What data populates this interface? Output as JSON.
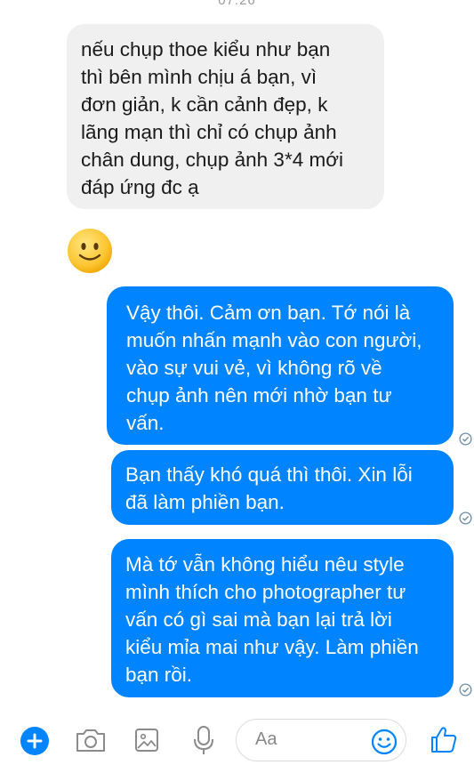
{
  "timestamp": "07:26",
  "messages": [
    {
      "sender": "other",
      "lines": [
        "nếu chụp thoe kiểu như bạn",
        "thì bên mình chịu á bạn, vì",
        "đơn giản, k cần cảnh đẹp, k",
        "lãng mạn thì chỉ có chụp ảnh",
        "chân dung, chụp ảnh 3*4 mới",
        "đáp ứng đc ạ"
      ]
    },
    {
      "sender": "other",
      "type": "emoji",
      "icon": "smiley-emoji-icon"
    },
    {
      "sender": "me",
      "lines": [
        "Vậy thôi. Cảm ơn bạn. Tớ nói là",
        "muốn nhấn mạnh vào con người,",
        "vào sự vui vẻ, vì không rõ về",
        "chụp ảnh nên mới nhờ bạn tư",
        "vấn."
      ]
    },
    {
      "sender": "me",
      "lines": [
        "Bạn thấy khó quá thì thôi. Xin lỗi",
        "đã làm phiền bạn."
      ]
    },
    {
      "sender": "me",
      "lines": [
        "Mà tớ vẫn không hiểu nêu style",
        "mình thích cho photographer tư",
        "vấn có gì sai mà bạn lại trả lời",
        "kiểu mỉa mai như vậy. Làm phiền",
        "bạn rồi."
      ]
    }
  ],
  "composer": {
    "placeholder": "Aa",
    "icons": [
      "plus-icon",
      "camera-icon",
      "gallery-icon",
      "microphone-icon",
      "emoji-icon",
      "thumbs-up-icon"
    ]
  },
  "colors": {
    "accent": "#0084ff",
    "incoming_bubble": "#f1f0f0",
    "background": "#ffffff"
  }
}
